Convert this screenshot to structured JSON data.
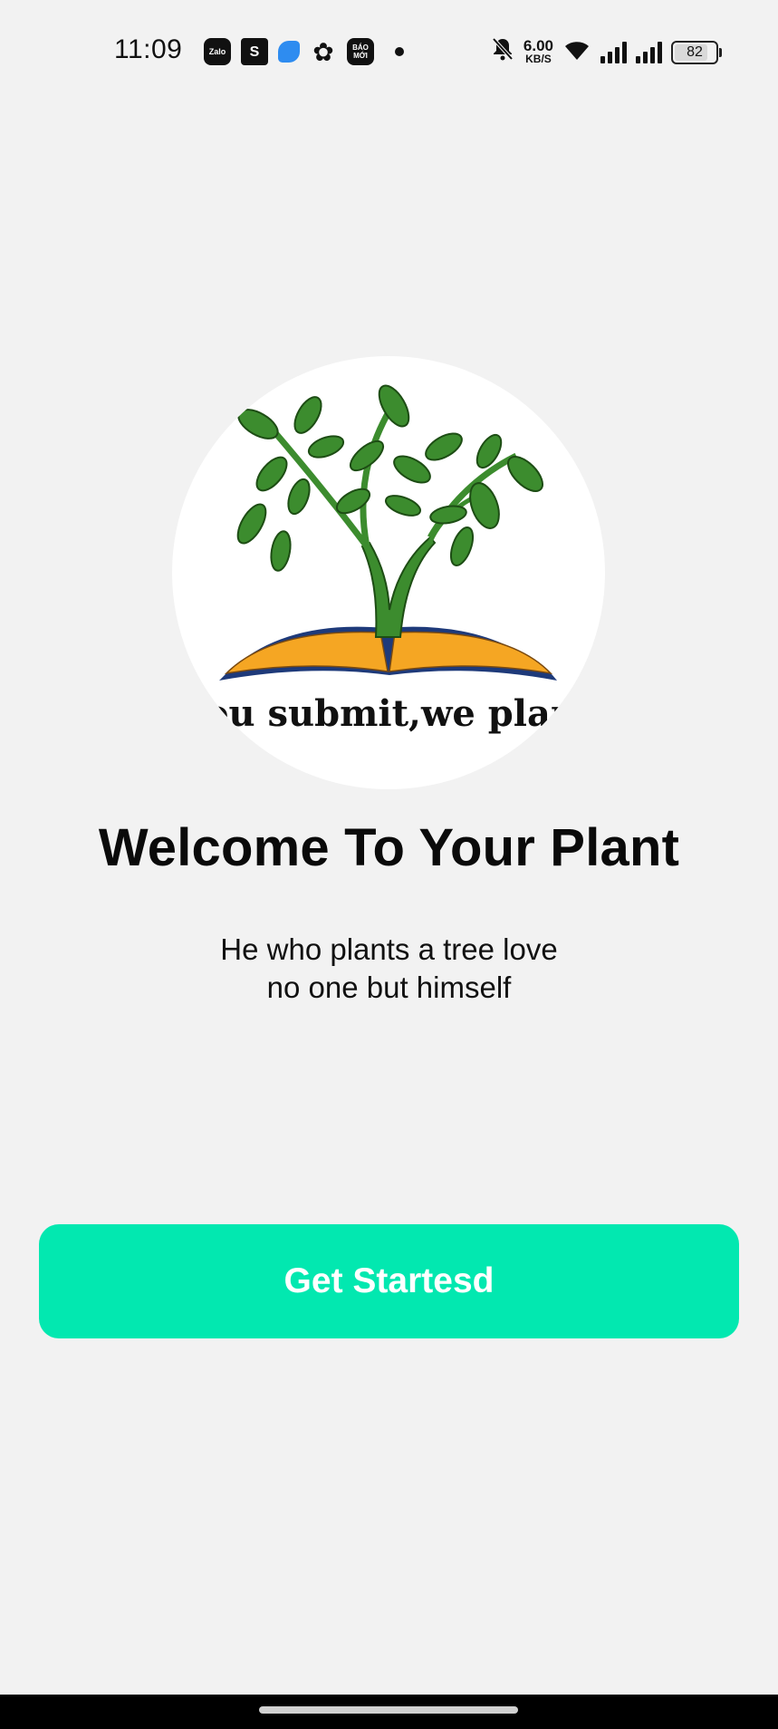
{
  "status_bar": {
    "time": "11:09",
    "app_icons": [
      {
        "name": "zalo-icon",
        "label": "Zalo"
      },
      {
        "name": "shopee-icon",
        "label": "S"
      },
      {
        "name": "blue-app-icon",
        "label": ""
      },
      {
        "name": "flower-app-icon",
        "label": ""
      },
      {
        "name": "baomoi-icon",
        "label": "BÁO MỚI"
      }
    ],
    "net_speed_value": "6.00",
    "net_speed_unit": "KB/S",
    "battery_level": "82",
    "battery_fraction": 0.82
  },
  "logo": {
    "tagline": "you submit,we plant",
    "colors": {
      "leaf": "#3c8c2e",
      "book": "#f5a623",
      "book_edge": "#1e3a7a"
    }
  },
  "main": {
    "title": "Welcome To Your Plant",
    "subtitle_line1": "He who plants a tree love",
    "subtitle_line2": "no one but himself"
  },
  "actions": {
    "get_started_label": "Get Startesd",
    "button_color": "#02e8b0"
  }
}
